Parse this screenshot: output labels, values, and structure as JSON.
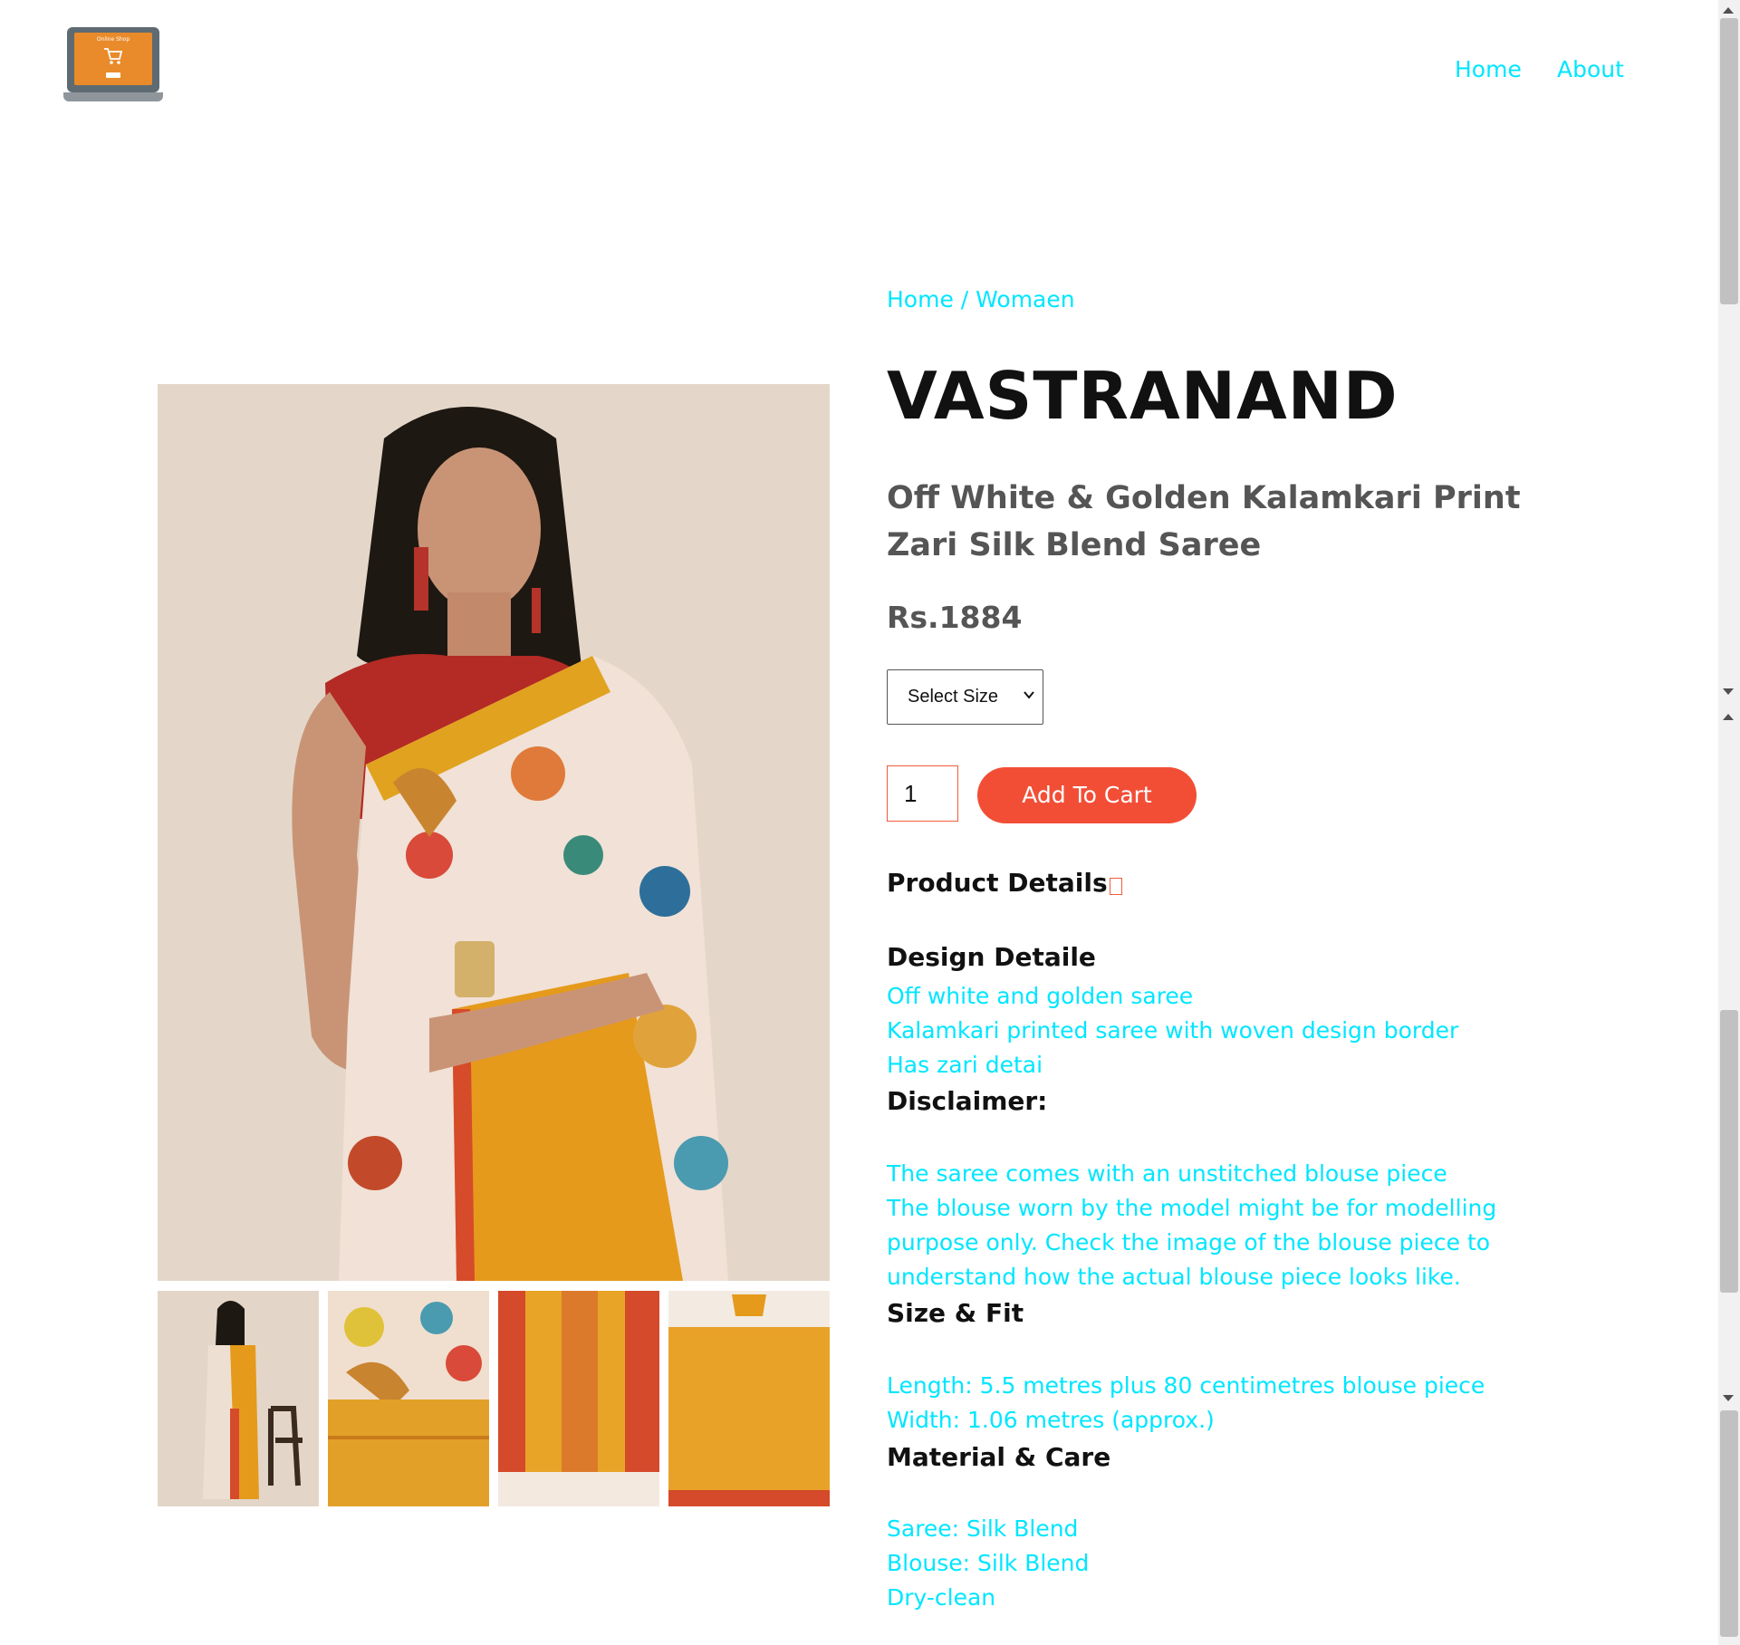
{
  "header": {
    "logo_text": "Online Shop",
    "nav": [
      "Home",
      "About"
    ]
  },
  "breadcrumb": [
    "Home",
    "Womaen"
  ],
  "product": {
    "brand": "VASTRANAND",
    "title": "Off White & Golden Kalamkari Print Zari Silk Blend Saree",
    "price": "Rs.1884",
    "size_select": "Select Size",
    "quantity": "1",
    "add_to_cart": "Add To Cart",
    "details_heading": "Product Details"
  },
  "sections": {
    "design": {
      "heading": "Design Detaile",
      "lines": [
        "Off white and golden saree",
        "Kalamkari printed saree with woven design border",
        "Has zari detai"
      ]
    },
    "disclaimer": {
      "heading": "Disclaimer:",
      "lines": [
        "The saree comes with an unstitched blouse piece",
        "The blouse worn by the model might be for modelling",
        "purpose only. Check the image of the blouse piece to",
        "understand how the actual blouse piece looks like."
      ]
    },
    "size_fit": {
      "heading": "Size & Fit",
      "lines": [
        "Length: 5.5 metres plus 80 centimetres blouse piece",
        "Width: 1.06 metres (approx.)"
      ]
    },
    "material": {
      "heading": "Material & Care",
      "lines": [
        "Saree: Silk Blend",
        "Blouse: Silk Blend",
        "Dry-clean"
      ]
    }
  },
  "colors": {
    "link": "#00e6ff",
    "cart_button": "#f24e36",
    "logo": "#e98b2a"
  }
}
